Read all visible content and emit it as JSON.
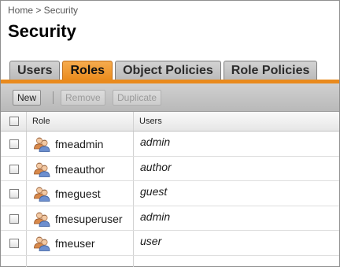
{
  "breadcrumb": "Home > Security",
  "page_title": "Security",
  "tabs": [
    {
      "label": "Users",
      "active": false
    },
    {
      "label": "Roles",
      "active": true
    },
    {
      "label": "Object Policies",
      "active": false
    },
    {
      "label": "Role Policies",
      "active": false
    }
  ],
  "toolbar": {
    "new_label": "New",
    "remove_label": "Remove",
    "duplicate_label": "Duplicate"
  },
  "table": {
    "columns": [
      "Role",
      "Users"
    ],
    "rows": [
      {
        "role": "fmeadmin",
        "users": "admin"
      },
      {
        "role": "fmeauthor",
        "users": "author"
      },
      {
        "role": "fmeguest",
        "users": "guest"
      },
      {
        "role": "fmesuperuser",
        "users": "admin"
      },
      {
        "role": "fmeuser",
        "users": "user"
      }
    ]
  },
  "colors": {
    "accent": "#e98a1d",
    "tab_inactive": "#c6c6c6",
    "toolbar": "#c4c4c4"
  },
  "icons": {
    "role_icon": "users-group-icon"
  }
}
